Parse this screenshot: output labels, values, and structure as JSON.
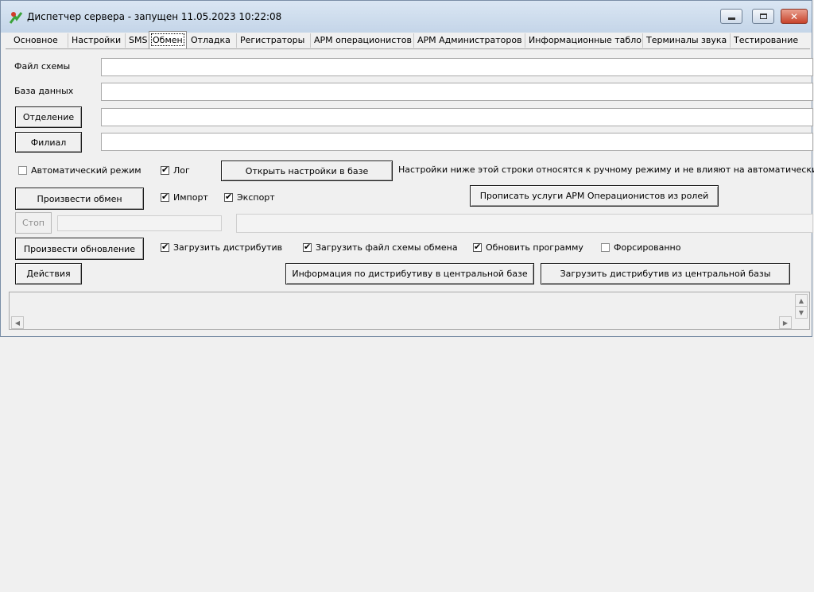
{
  "window": {
    "title": "Диспетчер сервера - запущен 11.05.2023 10:22:08",
    "icon": "app-icon"
  },
  "tabs": [
    {
      "label": "Основное"
    },
    {
      "label": "Настройки"
    },
    {
      "label": "SMS"
    },
    {
      "label": "Обмен",
      "active": true
    },
    {
      "label": "Отладка"
    },
    {
      "label": "Регистраторы"
    },
    {
      "label": "АРМ операционистов"
    },
    {
      "label": "АРМ Администраторов"
    },
    {
      "label": "Информационные табло"
    },
    {
      "label": "Терминалы звука"
    },
    {
      "label": "Тестирование"
    }
  ],
  "fields": {
    "scheme_file_label": "Файл схемы",
    "scheme_file_value": "",
    "database_label": "База данных",
    "database_value": "",
    "department_button": "Отделение",
    "department_value": "",
    "branch_button": "Филиал",
    "branch_value": ""
  },
  "options": {
    "auto_mode": "Автоматический режим",
    "auto_mode_checked": false,
    "log": "Лог",
    "log_checked": true,
    "open_settings_button": "Открыть настройки в базе",
    "manual_note": "Настройки ниже этой строки относятся к ручному режиму и не влияют на автоматический"
  },
  "exchange": {
    "do_exchange_button": "Произвести обмен",
    "import": "Импорт",
    "import_checked": true,
    "export": "Экспорт",
    "export_checked": true,
    "write_services_button": "Прописать услуги АРМ Операционистов из ролей",
    "stop_button": "Стоп"
  },
  "update": {
    "do_update_button": "Произвести обновление",
    "load_distrib": "Загрузить дистрибутив",
    "load_distrib_checked": true,
    "load_scheme": "Загрузить файл схемы обмена",
    "load_scheme_checked": true,
    "update_program": "Обновить программу",
    "update_program_checked": true,
    "forced": "Форсированно",
    "forced_checked": false
  },
  "actions": {
    "actions_button": "Действия",
    "distrib_info_button": "Информация по дистрибутиву в центральной базе",
    "load_from_central_button": "Загрузить дистрибутив из центральной базы"
  },
  "colors": {
    "titlebar": "#c4d5e8",
    "close_button": "#c8432b",
    "background": "#f0f0f0"
  }
}
